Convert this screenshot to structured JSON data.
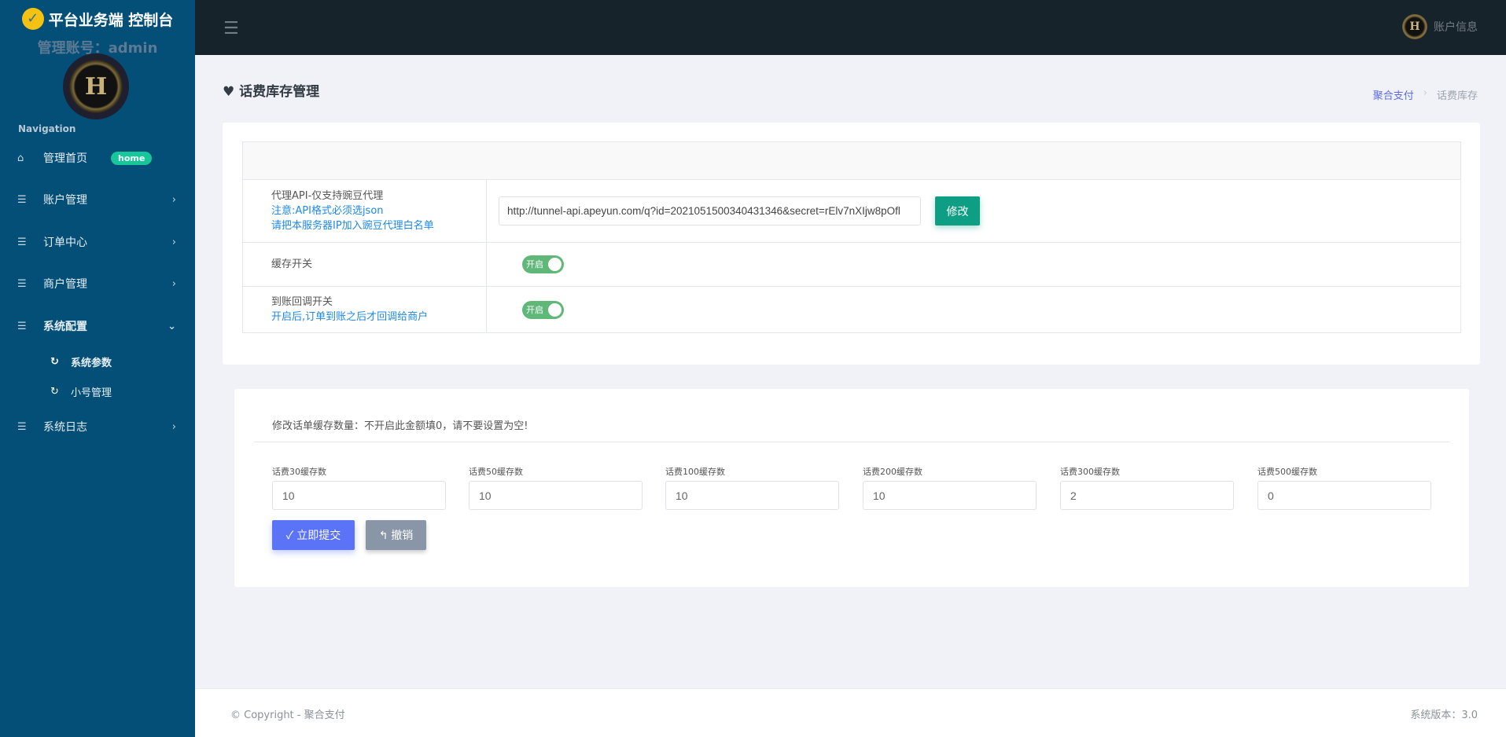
{
  "sidebar": {
    "brand": "平台业务端 控制台",
    "account": "管理账号：admin",
    "avatar_letter": "H",
    "nav_label": "Navigation",
    "items": [
      {
        "label": "管理首页",
        "icon": "home-icon",
        "badge": "home"
      },
      {
        "label": "账户管理",
        "icon": "list-icon"
      },
      {
        "label": "订单中心",
        "icon": "list-icon"
      },
      {
        "label": "商户管理",
        "icon": "list-icon"
      },
      {
        "label": "系统配置",
        "icon": "list-icon",
        "expanded": true,
        "children": [
          {
            "label": "系统参数",
            "active": true
          },
          {
            "label": "小号管理"
          }
        ]
      },
      {
        "label": "系统日志",
        "icon": "list-icon"
      }
    ]
  },
  "topbar": {
    "user_label": "账户信息",
    "avatar_letter": "H"
  },
  "page": {
    "title": "话费库存管理",
    "breadcrumb": [
      "聚合支付",
      "话费库存"
    ]
  },
  "settings": {
    "api": {
      "label": "代理API-仅支持豌豆代理",
      "note1": "注意:API格式必须选json",
      "note2": "请把本服务器IP加入豌豆代理白名单",
      "value": "http://tunnel-api.apeyun.com/q?id=2021051500340431346&secret=rElv7nXIjw8pOfl",
      "button": "修改"
    },
    "cache": {
      "label": "缓存开关",
      "toggle": "开启",
      "on": true
    },
    "callback": {
      "label": "到账回调开关",
      "note": "开启后,订单到账之后才回调给商户",
      "toggle": "开启",
      "on": true
    }
  },
  "stock": {
    "title": "修改话单缓存数量：不开启此金额填0，请不要设置为空!",
    "fields": [
      {
        "label": "话费30缓存数",
        "value": "10"
      },
      {
        "label": "话费50缓存数",
        "value": "10"
      },
      {
        "label": "话费100缓存数",
        "value": "10"
      },
      {
        "label": "话费200缓存数",
        "value": "10"
      },
      {
        "label": "话费300缓存数",
        "value": "2"
      },
      {
        "label": "话费500缓存数",
        "value": "0"
      }
    ],
    "submit": "立即提交",
    "cancel": "撤销"
  },
  "footer": {
    "copyright": "© Copyright - 聚合支付",
    "version": "系统版本：3.0"
  },
  "colors": {
    "sidebar": "#034f78",
    "topbar": "#16232b",
    "primary": "#5b73f7",
    "success": "#0e9e84",
    "toggle": "#5fb878"
  }
}
